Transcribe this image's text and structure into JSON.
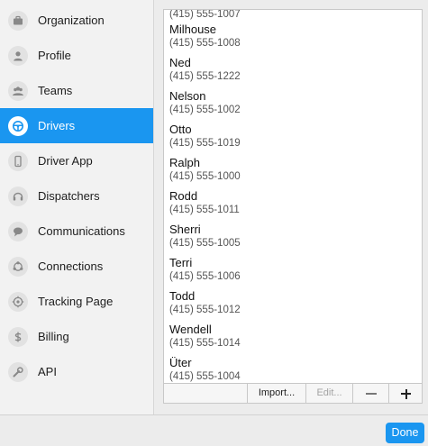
{
  "colors": {
    "accent": "#1a96f0",
    "sidebar_background": "#f2f2f2",
    "window_background": "#ececec"
  },
  "sidebar": {
    "items": [
      {
        "label": "Organization",
        "icon": "briefcase-icon",
        "active": false
      },
      {
        "label": "Profile",
        "icon": "user-icon",
        "active": false
      },
      {
        "label": "Teams",
        "icon": "group-icon",
        "active": false
      },
      {
        "label": "Drivers",
        "icon": "steering-wheel-icon",
        "active": true
      },
      {
        "label": "Driver App",
        "icon": "phone-icon",
        "active": false
      },
      {
        "label": "Dispatchers",
        "icon": "headset-icon",
        "active": false
      },
      {
        "label": "Communications",
        "icon": "chat-bubble-icon",
        "active": false
      },
      {
        "label": "Connections",
        "icon": "connections-icon",
        "active": false
      },
      {
        "label": "Tracking Page",
        "icon": "target-icon",
        "active": false
      },
      {
        "label": "Billing",
        "icon": "dollar-icon",
        "active": false
      },
      {
        "label": "API",
        "icon": "wrench-icon",
        "active": false
      }
    ]
  },
  "drivers": {
    "partial_top_phone": "(415) 555-1007",
    "items": [
      {
        "name": "Milhouse",
        "phone": "(415) 555-1008"
      },
      {
        "name": "Ned",
        "phone": "(415) 555-1222"
      },
      {
        "name": "Nelson",
        "phone": "(415) 555-1002"
      },
      {
        "name": "Otto",
        "phone": "(415) 555-1019"
      },
      {
        "name": "Ralph",
        "phone": "(415) 555-1000"
      },
      {
        "name": "Rodd",
        "phone": "(415) 555-1011"
      },
      {
        "name": "Sherri",
        "phone": "(415) 555-1005"
      },
      {
        "name": "Terri",
        "phone": "(415) 555-1006"
      },
      {
        "name": "Todd",
        "phone": "(415) 555-1012"
      },
      {
        "name": "Wendell",
        "phone": "(415) 555-1014"
      },
      {
        "name": "Üter",
        "phone": "(415) 555-1004"
      }
    ]
  },
  "toolbar": {
    "import_label": "Import...",
    "edit_label": "Edit...",
    "remove_icon": "minus-icon",
    "add_icon": "plus-icon"
  },
  "footer": {
    "done_label": "Done"
  }
}
